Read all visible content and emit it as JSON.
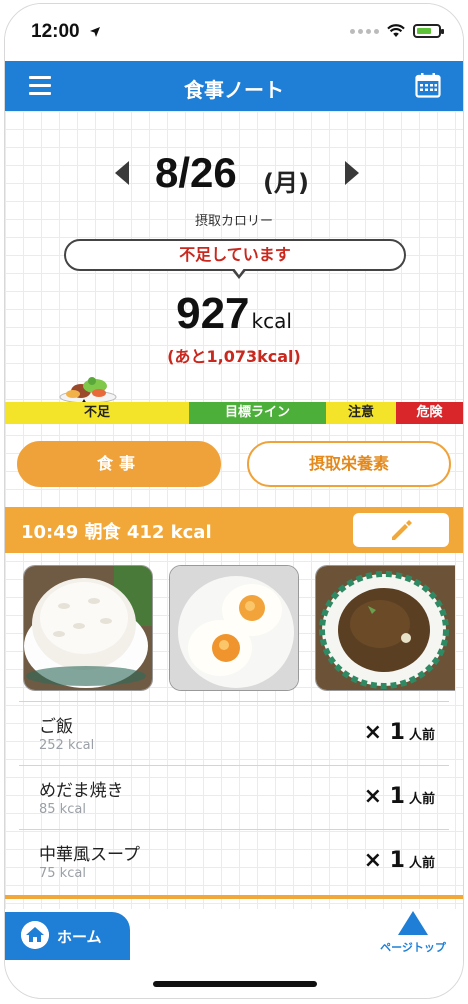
{
  "status": {
    "time": "12:00"
  },
  "nav": {
    "title": "食事ノート"
  },
  "day": {
    "date": "8/26",
    "weekday": "(月)",
    "intake_label": "摂取カロリー"
  },
  "calorie": {
    "message": "不足しています",
    "value": "927",
    "unit": "kcal",
    "remaining": "(あと1,073kcal)"
  },
  "scale": {
    "short": "不足",
    "target": "目標ライン",
    "caution": "注意",
    "danger": "危険"
  },
  "tabs": {
    "meal": "食事",
    "nutrition": "摂取栄養素"
  },
  "meal": {
    "title": "10:49 朝食 412 kcal",
    "photos": [
      "rice-photo",
      "fried-egg-photo",
      "soup-photo"
    ],
    "items": [
      {
        "name": "ご飯",
        "kcal": "252 kcal",
        "x": "×",
        "qty": "1",
        "unit": "人前"
      },
      {
        "name": "めだま焼き",
        "kcal": "85 kcal",
        "x": "×",
        "qty": "1",
        "unit": "人前"
      },
      {
        "name": "中華風スープ",
        "kcal": "75 kcal",
        "x": "×",
        "qty": "1",
        "unit": "人前"
      }
    ]
  },
  "footer": {
    "home": "ホーム",
    "page_top": "ページトップ"
  },
  "colors": {
    "primary": "#1f7fd6",
    "accent": "#f2a838",
    "alert": "#c8281e"
  }
}
